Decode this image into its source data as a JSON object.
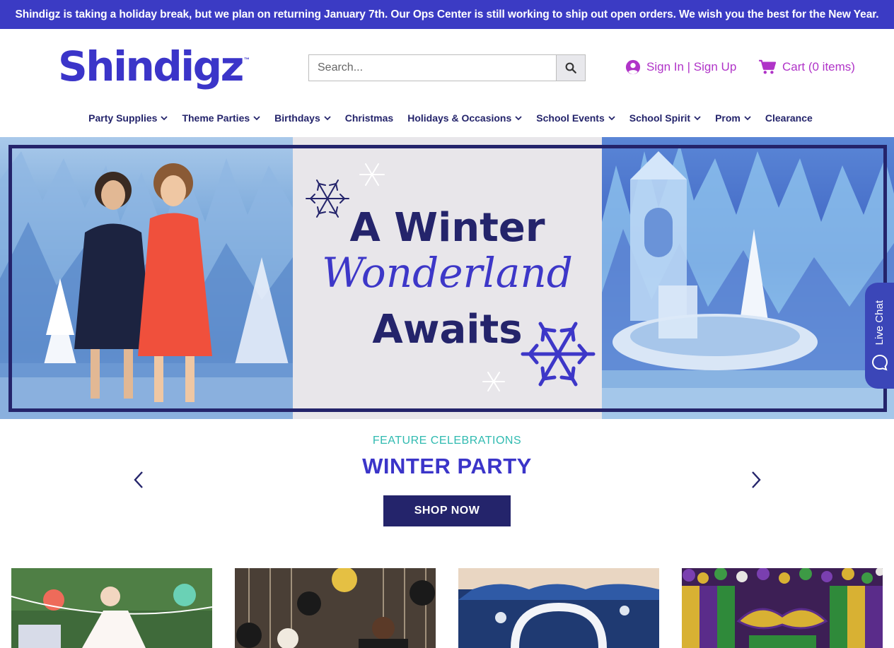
{
  "announcement": {
    "text": "Shindigz is taking a holiday break, but we plan on returning January 7th. Our Ops Center is still working to ship out open orders. We wish you the best for the New Year."
  },
  "header": {
    "logo_text": "Shindigz",
    "logo_tm": "™",
    "search_placeholder": "Search...",
    "search_icon": "search-icon",
    "signin_label": "Sign In | Sign Up",
    "signin_icon": "user-circle-icon",
    "cart_label": "Cart (0 items)",
    "cart_icon": "shopping-cart-icon",
    "accent_color": "#b034c8",
    "brand_color": "#3b35c9"
  },
  "nav": {
    "items": [
      {
        "label": "Party Supplies",
        "has_dropdown": true
      },
      {
        "label": "Theme Parties",
        "has_dropdown": true
      },
      {
        "label": "Birthdays",
        "has_dropdown": true
      },
      {
        "label": "Christmas",
        "has_dropdown": false
      },
      {
        "label": "Holidays & Occasions",
        "has_dropdown": true
      },
      {
        "label": "School Events",
        "has_dropdown": true
      },
      {
        "label": "School Spirit",
        "has_dropdown": true
      },
      {
        "label": "Prom",
        "has_dropdown": true
      },
      {
        "label": "Clearance",
        "has_dropdown": false
      }
    ]
  },
  "hero": {
    "line1": "A Winter",
    "line2": "Wonderland",
    "line3": "Awaits"
  },
  "live_chat": {
    "label": "Live Chat",
    "icon": "chat-bubble-icon"
  },
  "feature": {
    "eyebrow": "FEATURE CELEBRATIONS",
    "title": "WINTER PARTY",
    "button_label": "SHOP NOW",
    "prev_icon": "chevron-left-icon",
    "next_icon": "chevron-right-icon"
  },
  "tiles": [
    {
      "theme": "garden-party-photo"
    },
    {
      "theme": "new-years-photo"
    },
    {
      "theme": "winter-arch-photo"
    },
    {
      "theme": "mardi-gras-photo"
    }
  ]
}
